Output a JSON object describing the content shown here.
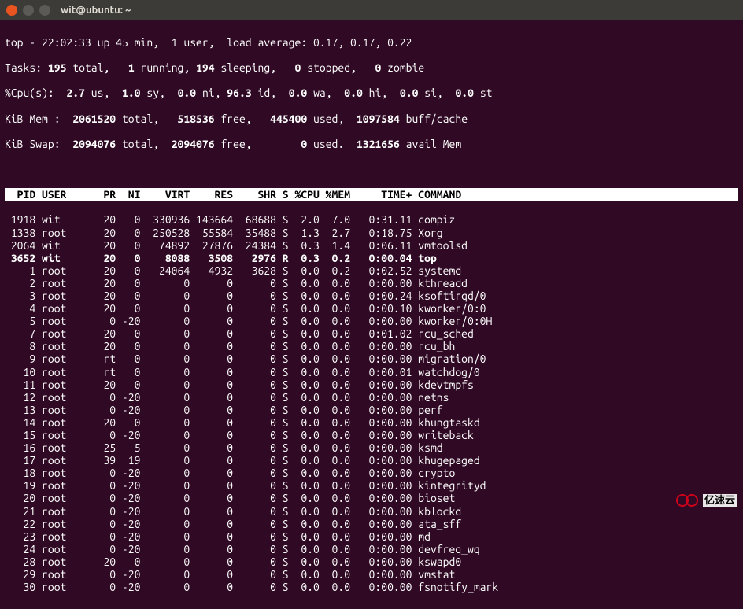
{
  "window": {
    "title": "wit@ubuntu: ~"
  },
  "summary": {
    "line1": "top - 22:02:33 up 45 min,  1 user,  load average: 0.17, 0.17, 0.22",
    "tasks_label": "Tasks:",
    "tasks_total": " 195 ",
    "tasks_total_lbl": "total,",
    "tasks_running": "   1 ",
    "tasks_running_lbl": "running,",
    "tasks_sleeping": " 194 ",
    "tasks_sleeping_lbl": "sleeping,",
    "tasks_stopped": "   0 ",
    "tasks_stopped_lbl": "stopped,",
    "tasks_zombie": "   0 ",
    "tasks_zombie_lbl": "zombie",
    "cpu_label": "%Cpu(s):",
    "cpu_us": "  2.7 ",
    "cpu_us_lbl": "us,",
    "cpu_sy": "  1.0 ",
    "cpu_sy_lbl": "sy,",
    "cpu_ni": "  0.0 ",
    "cpu_ni_lbl": "ni,",
    "cpu_id": " 96.3 ",
    "cpu_id_lbl": "id,",
    "cpu_wa": "  0.0 ",
    "cpu_wa_lbl": "wa,",
    "cpu_hi": "  0.0 ",
    "cpu_hi_lbl": "hi,",
    "cpu_si": "  0.0 ",
    "cpu_si_lbl": "si,",
    "cpu_st": "  0.0 ",
    "cpu_st_lbl": "st",
    "mem_label": "KiB Mem :",
    "mem_total": "  2061520 ",
    "mem_total_lbl": "total,",
    "mem_free": "   518536 ",
    "mem_free_lbl": "free,",
    "mem_used": "   445400 ",
    "mem_used_lbl": "used,",
    "mem_buff": "  1097584 ",
    "mem_buff_lbl": "buff/cache",
    "swap_label": "KiB Swap:",
    "swap_total": "  2094076 ",
    "swap_total_lbl": "total,",
    "swap_free": "  2094076 ",
    "swap_free_lbl": "free,",
    "swap_used": "        0 ",
    "swap_used_lbl": "used.",
    "swap_avail": "  1321656 ",
    "swap_avail_lbl": "avail Mem "
  },
  "header": "  PID USER      PR  NI    VIRT    RES    SHR S %CPU %MEM     TIME+ COMMAND                                ",
  "processes": [
    {
      "bold": false,
      "line": " 1918 wit       20   0  330936 143664  68688 S  2.0  7.0   0:31.11 compiz"
    },
    {
      "bold": false,
      "line": " 1338 root      20   0  250528  55584  35488 S  1.3  2.7   0:18.75 Xorg"
    },
    {
      "bold": false,
      "line": " 2064 wit       20   0   74892  27876  24384 S  0.3  1.4   0:06.11 vmtoolsd"
    },
    {
      "bold": true,
      "line": " 3652 wit       20   0    8088   3508   2976 R  0.3  0.2   0:00.04 top"
    },
    {
      "bold": false,
      "line": "    1 root      20   0   24064   4932   3628 S  0.0  0.2   0:02.52 systemd"
    },
    {
      "bold": false,
      "line": "    2 root      20   0       0      0      0 S  0.0  0.0   0:00.00 kthreadd"
    },
    {
      "bold": false,
      "line": "    3 root      20   0       0      0      0 S  0.0  0.0   0:00.24 ksoftirqd/0"
    },
    {
      "bold": false,
      "line": "    4 root      20   0       0      0      0 S  0.0  0.0   0:00.10 kworker/0:0"
    },
    {
      "bold": false,
      "line": "    5 root       0 -20       0      0      0 S  0.0  0.0   0:00.00 kworker/0:0H"
    },
    {
      "bold": false,
      "line": "    7 root      20   0       0      0      0 S  0.0  0.0   0:01.02 rcu_sched"
    },
    {
      "bold": false,
      "line": "    8 root      20   0       0      0      0 S  0.0  0.0   0:00.00 rcu_bh"
    },
    {
      "bold": false,
      "line": "    9 root      rt   0       0      0      0 S  0.0  0.0   0:00.00 migration/0"
    },
    {
      "bold": false,
      "line": "   10 root      rt   0       0      0      0 S  0.0  0.0   0:00.01 watchdog/0"
    },
    {
      "bold": false,
      "line": "   11 root      20   0       0      0      0 S  0.0  0.0   0:00.00 kdevtmpfs"
    },
    {
      "bold": false,
      "line": "   12 root       0 -20       0      0      0 S  0.0  0.0   0:00.00 netns"
    },
    {
      "bold": false,
      "line": "   13 root       0 -20       0      0      0 S  0.0  0.0   0:00.00 perf"
    },
    {
      "bold": false,
      "line": "   14 root      20   0       0      0      0 S  0.0  0.0   0:00.00 khungtaskd"
    },
    {
      "bold": false,
      "line": "   15 root       0 -20       0      0      0 S  0.0  0.0   0:00.00 writeback"
    },
    {
      "bold": false,
      "line": "   16 root      25   5       0      0      0 S  0.0  0.0   0:00.00 ksmd"
    },
    {
      "bold": false,
      "line": "   17 root      39  19       0      0      0 S  0.0  0.0   0:00.00 khugepaged"
    },
    {
      "bold": false,
      "line": "   18 root       0 -20       0      0      0 S  0.0  0.0   0:00.00 crypto"
    },
    {
      "bold": false,
      "line": "   19 root       0 -20       0      0      0 S  0.0  0.0   0:00.00 kintegrityd"
    },
    {
      "bold": false,
      "line": "   20 root       0 -20       0      0      0 S  0.0  0.0   0:00.00 bioset"
    },
    {
      "bold": false,
      "line": "   21 root       0 -20       0      0      0 S  0.0  0.0   0:00.00 kblockd"
    },
    {
      "bold": false,
      "line": "   22 root       0 -20       0      0      0 S  0.0  0.0   0:00.00 ata_sff"
    },
    {
      "bold": false,
      "line": "   23 root       0 -20       0      0      0 S  0.0  0.0   0:00.00 md"
    },
    {
      "bold": false,
      "line": "   24 root       0 -20       0      0      0 S  0.0  0.0   0:00.00 devfreq_wq"
    },
    {
      "bold": false,
      "line": "   28 root      20   0       0      0      0 S  0.0  0.0   0:00.00 kswapd0"
    },
    {
      "bold": false,
      "line": "   29 root       0 -20       0      0      0 S  0.0  0.0   0:00.00 vmstat"
    },
    {
      "bold": false,
      "line": "   30 root       0 -20       0      0      0 S  0.0  0.0   0:00.00 fsnotify_mark"
    }
  ],
  "watermark": {
    "text": "亿速云"
  }
}
